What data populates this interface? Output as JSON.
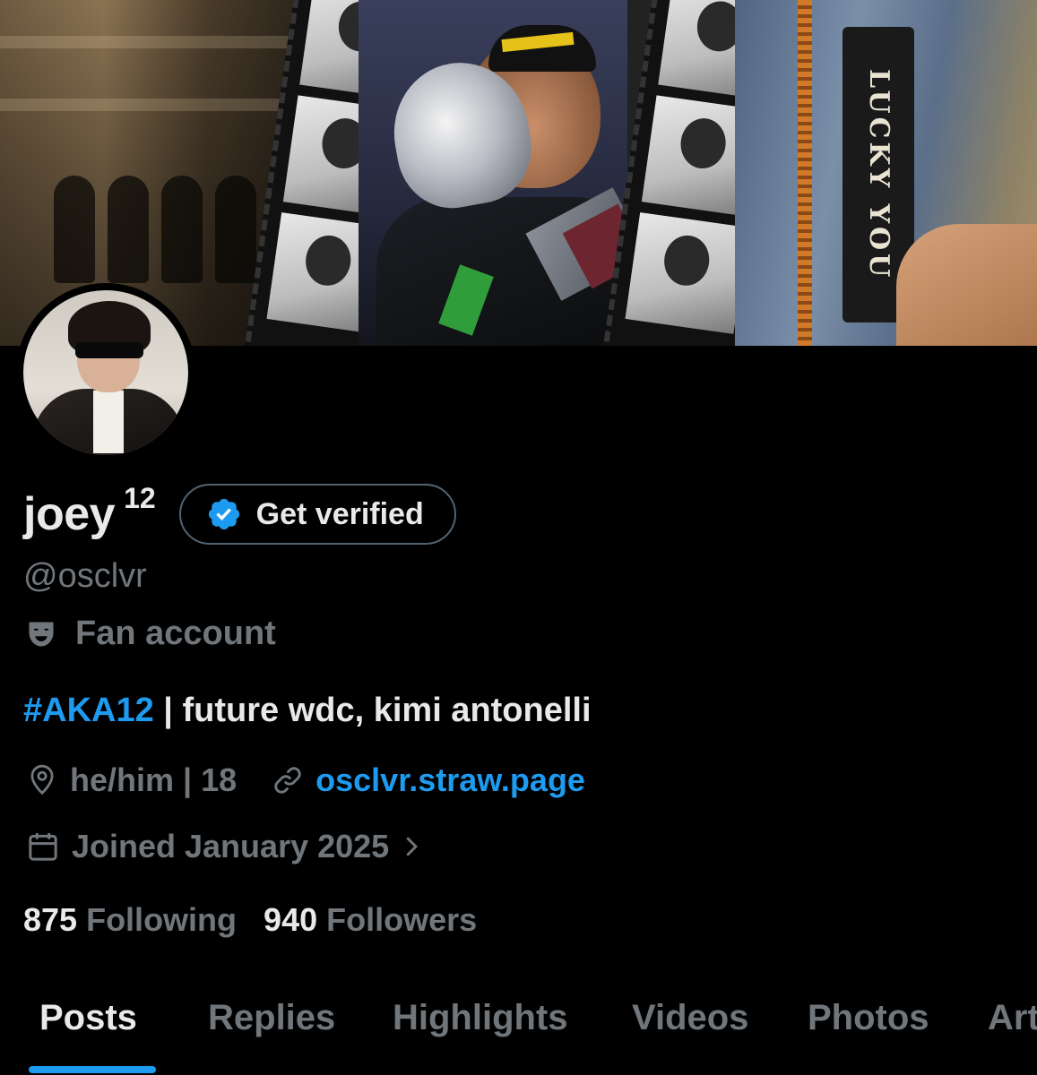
{
  "profile": {
    "display_name": "joey",
    "name_suffix": "12",
    "handle": "@osclvr",
    "category": "Fan account",
    "bio_hashtag": "#AKA12",
    "bio_text": " | future wdc, kimi antonelli",
    "location": "he/him | 18",
    "website": "osclvr.straw.page",
    "joined": "Joined January 2025"
  },
  "verify_button": {
    "label": "Get verified"
  },
  "banner": {
    "patch_text": "LUCKY YOU"
  },
  "stats": {
    "following_count": "875",
    "following_label": "Following",
    "followers_count": "940",
    "followers_label": "Followers"
  },
  "tabs": [
    {
      "label": "Posts",
      "active": true
    },
    {
      "label": "Replies",
      "active": false
    },
    {
      "label": "Highlights",
      "active": false
    },
    {
      "label": "Videos",
      "active": false
    },
    {
      "label": "Photos",
      "active": false
    },
    {
      "label": "Art",
      "active": false
    }
  ],
  "icons": {
    "verified": "verified-badge-icon",
    "category": "theater-mask-icon",
    "location": "location-pin-icon",
    "link": "link-icon",
    "calendar": "calendar-icon",
    "chevron": "chevron-right-icon"
  },
  "colors": {
    "background": "#000000",
    "text_primary": "#e7e9ea",
    "text_secondary": "#71767b",
    "accent": "#1d9bf0",
    "border": "#536471"
  }
}
